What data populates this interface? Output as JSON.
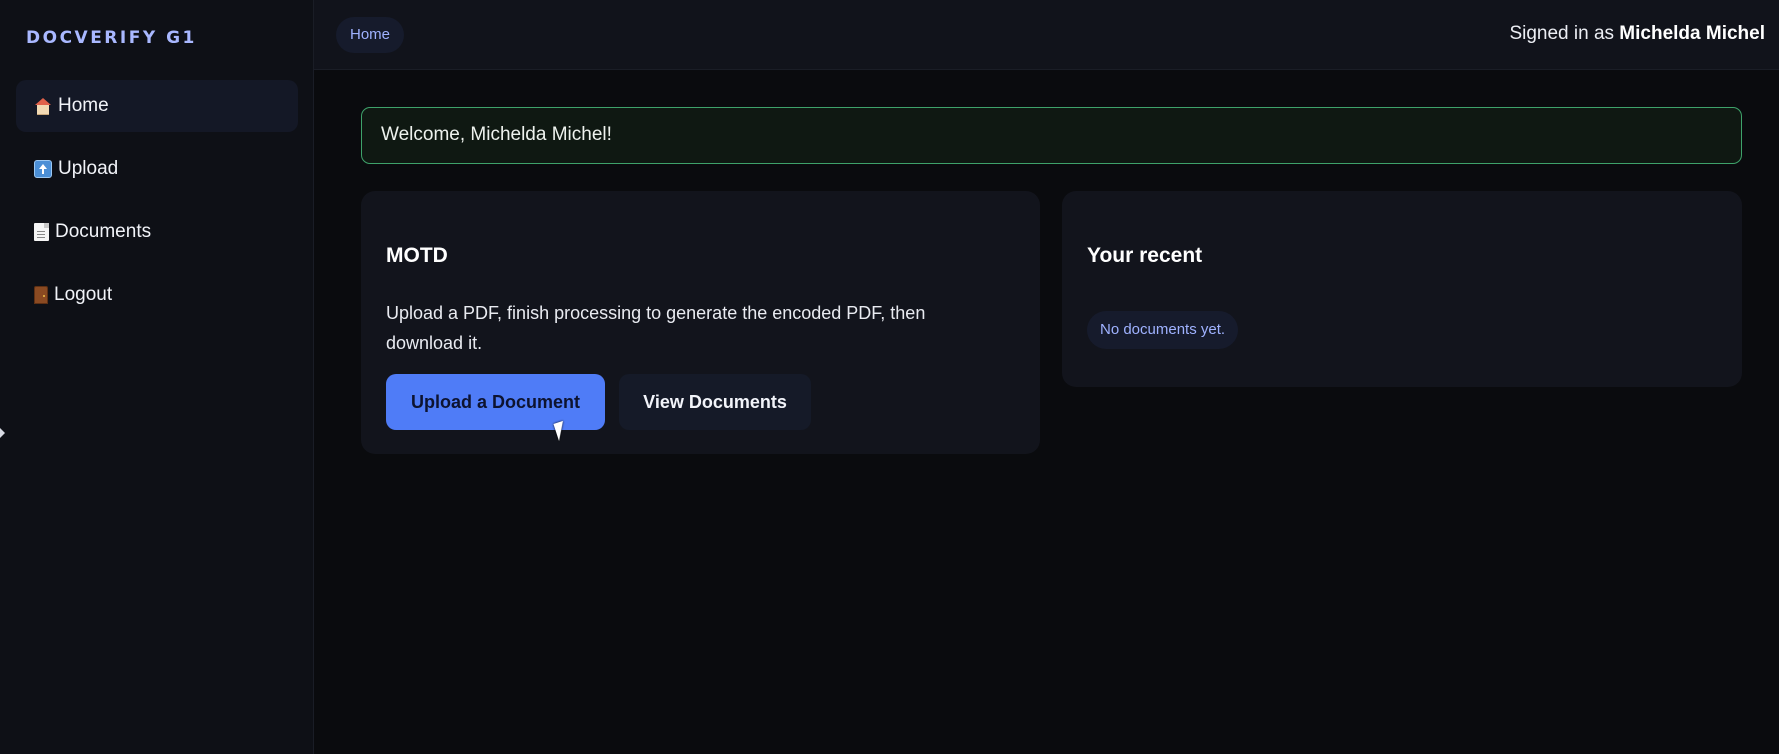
{
  "app": {
    "brand": "DOCVERIFY G1"
  },
  "sidebar": {
    "items": [
      {
        "label": "Home",
        "icon": "home-icon",
        "active": true
      },
      {
        "label": "Upload",
        "icon": "upload-icon",
        "active": false
      },
      {
        "label": "Documents",
        "icon": "document-icon",
        "active": false
      },
      {
        "label": "Logout",
        "icon": "door-icon",
        "active": false
      }
    ]
  },
  "header": {
    "breadcrumb": "Home",
    "signed_in_prefix": "Signed in as",
    "user_name": "Michelda Michel"
  },
  "main": {
    "welcome": "Welcome, Michelda Michel!",
    "motd": {
      "title": "MOTD",
      "text": "Upload a PDF, finish processing to generate the encoded PDF, then download it.",
      "primary_button": "Upload a Document",
      "secondary_button": "View Documents"
    },
    "recent": {
      "title": "Your recent",
      "empty_text": "No documents yet."
    }
  },
  "colors": {
    "accent": "#4f7cf7",
    "brand": "#a9b8ff",
    "success_border": "#3ea26a",
    "background": "#0a0b0e"
  }
}
